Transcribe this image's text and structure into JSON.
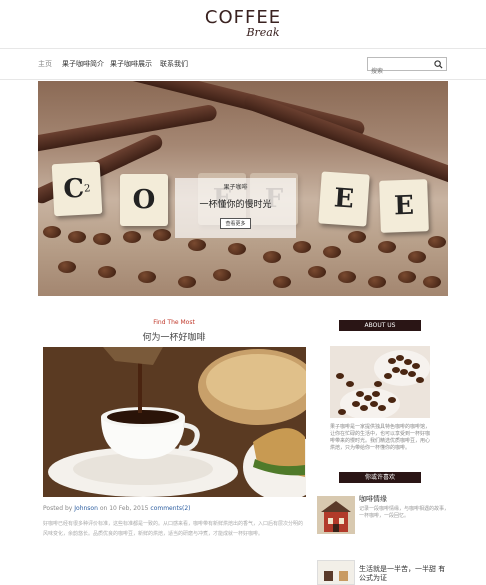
{
  "brand": {
    "logo_main": "COFFEE",
    "logo_sub": "Break"
  },
  "nav": {
    "items": [
      "主页",
      "果子咖啡简介",
      "果子咖啡展示",
      "联系我们"
    ],
    "active_index": 0
  },
  "search": {
    "placeholder": "搜索",
    "icon": "search-icon"
  },
  "hero": {
    "tiles": [
      "C",
      "2",
      "O",
      "F",
      "F",
      "E",
      "E"
    ],
    "caption": {
      "kicker": "果子咖啡",
      "title": "一杯懂你的慢时光",
      "button": "查看更多"
    }
  },
  "post": {
    "kicker": "Find The Most",
    "title": "何为一杯好咖啡",
    "meta": {
      "posted_by": "Posted by",
      "author": "Johnson",
      "date_text": "on 10 Feb, 2015",
      "comments": "comments(2)"
    },
    "excerpt": "好咖啡已经有很多种评价标准，这些标准都是一致的。从口感来看，咖啡带有新鲜烘焙出的香气，入口后有层次分明的风味变化，余韵悠长。品质优良的咖啡豆，新鲜的烘焙，适当的研磨与冲煮，才能成就一杯好咖啡。"
  },
  "sidebar": {
    "about": {
      "heading": "ABOUT US",
      "text": "果子咖啡是一家提供独具特色咖啡的咖啡馆，让你在忙碌的生活中，也可以享受到一杯好咖啡带来的慢时光。我们精选优质咖啡豆，用心烘焙，只为带给你一杯懂你的咖啡。"
    },
    "recommend": {
      "heading": "你或许喜欢",
      "items": [
        {
          "title": "咖啡情缘",
          "desc": "记录一段咖啡情缘，与咖啡相遇的故事，一杯咖啡，一段回忆。"
        },
        {
          "title": "生活就是一半苦，一半甜 有公式为证"
        }
      ]
    }
  },
  "colors": {
    "accent": "#2a1515",
    "link": "#2b5da0",
    "kicker": "#c0392b"
  }
}
